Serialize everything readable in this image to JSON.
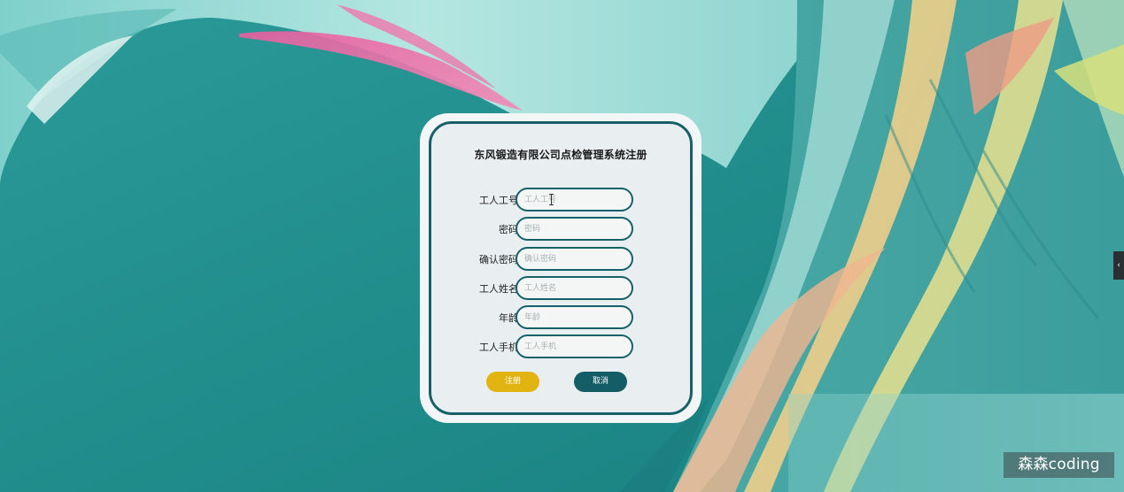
{
  "page": {
    "title": "东风锻造有限公司点检管理系统注册"
  },
  "form": {
    "fields": [
      {
        "key": "worker_id",
        "label": "工人工号",
        "placeholder": "工人工号",
        "value": ""
      },
      {
        "key": "password",
        "label": "密码",
        "placeholder": "密码",
        "value": ""
      },
      {
        "key": "confirm_password",
        "label": "确认密码",
        "placeholder": "确认密码",
        "value": ""
      },
      {
        "key": "worker_name",
        "label": "工人姓名",
        "placeholder": "工人姓名",
        "value": ""
      },
      {
        "key": "age",
        "label": "年龄",
        "placeholder": "年龄",
        "value": ""
      },
      {
        "key": "phone",
        "label": "工人手机",
        "placeholder": "工人手机",
        "value": ""
      }
    ],
    "register_label": "注册",
    "cancel_label": "取消"
  },
  "side_tab": {
    "icon": "chevron-left-icon",
    "glyph": "‹"
  },
  "watermark": {
    "text": "森森coding"
  },
  "colors": {
    "background_teal": "#1f8a8a",
    "card_border": "#16606a",
    "register_button": "#e1b412",
    "cancel_button": "#145d66"
  }
}
